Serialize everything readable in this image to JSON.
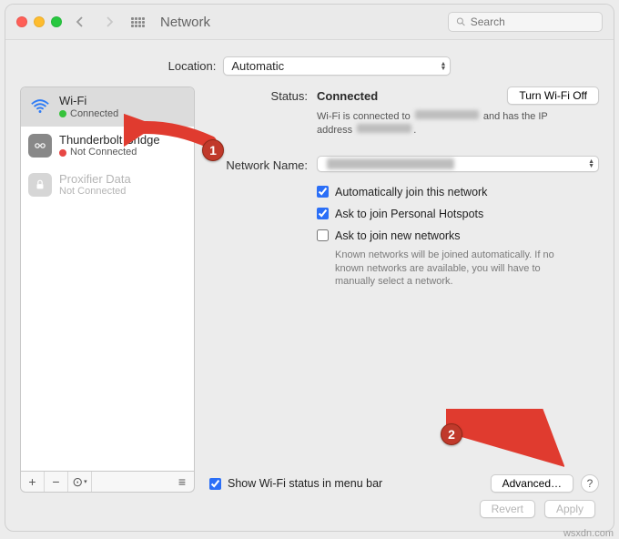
{
  "toolbar": {
    "title": "Network",
    "search_placeholder": "Search"
  },
  "location": {
    "label": "Location:",
    "value": "Automatic"
  },
  "services": [
    {
      "name": "Wi-Fi",
      "status": "Connected",
      "status_color": "green",
      "icon": "wifi",
      "selected": true
    },
    {
      "name": "Thunderbolt Bridge",
      "status": "Not Connected",
      "status_color": "red",
      "icon": "thunderbolt",
      "selected": false
    },
    {
      "name": "Proxifier Data",
      "status": "Not Connected",
      "status_color": "grey",
      "icon": "lock",
      "selected": false,
      "disabled": true
    }
  ],
  "detail": {
    "status_label": "Status:",
    "status_value": "Connected",
    "wifi_toggle": "Turn Wi-Fi Off",
    "status_desc_prefix": "Wi-Fi is connected to",
    "status_desc_middle": "and has the IP address",
    "network_name_label": "Network Name:",
    "network_name_value": "••••••",
    "options": {
      "auto_join": {
        "label": "Automatically join this network",
        "checked": true
      },
      "ask_hotspots": {
        "label": "Ask to join Personal Hotspots",
        "checked": true
      },
      "ask_new": {
        "label": "Ask to join new networks",
        "checked": false
      },
      "ask_new_hint": "Known networks will be joined automatically. If no known networks are available, you will have to manually select a network."
    },
    "show_menubar": {
      "label": "Show Wi-Fi status in menu bar",
      "checked": true
    },
    "advanced": "Advanced…",
    "help": "?"
  },
  "footer": {
    "revert": "Revert",
    "apply": "Apply"
  },
  "list_controls": {
    "add": "+",
    "remove": "−",
    "actions": "⊙",
    "drag": "≡"
  },
  "callouts": {
    "one": "1",
    "two": "2"
  },
  "watermark": "wsxdn.com"
}
